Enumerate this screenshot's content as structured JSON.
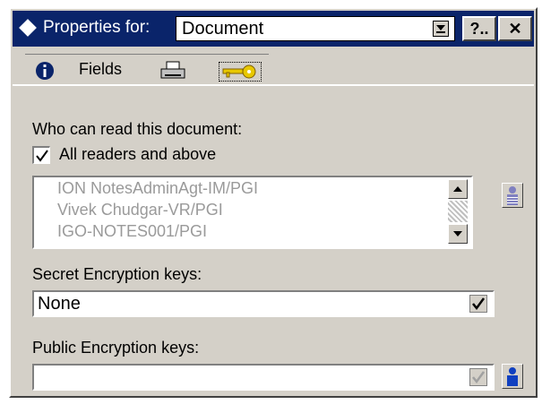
{
  "window": {
    "title_label": "Properties for:",
    "selected_object": "Document",
    "help_label": "?..",
    "close_label": "✕"
  },
  "tabs": [
    {
      "name": "info",
      "label": "",
      "icon": "info-icon"
    },
    {
      "name": "fields",
      "label": "Fields",
      "icon": ""
    },
    {
      "name": "print",
      "label": "",
      "icon": "printer-icon"
    },
    {
      "name": "security",
      "label": "",
      "icon": "key-icon",
      "selected": true
    }
  ],
  "readers": {
    "heading": "Who can read this document:",
    "all_readers_label": "All readers and above",
    "all_readers_checked": true,
    "names": [
      "ION NotesAdminAgt-IM/PGI",
      "Vivek Chudgar-VR/PGI",
      "IGO-NOTES001/PGI"
    ]
  },
  "secret_keys": {
    "label": "Secret Encryption keys:",
    "value": "None"
  },
  "public_keys": {
    "label": "Public Encryption keys:",
    "value": ""
  },
  "colors": {
    "titlebar": "#0a246a",
    "face": "#d4d0c8",
    "person_icon": "#1040c0"
  }
}
